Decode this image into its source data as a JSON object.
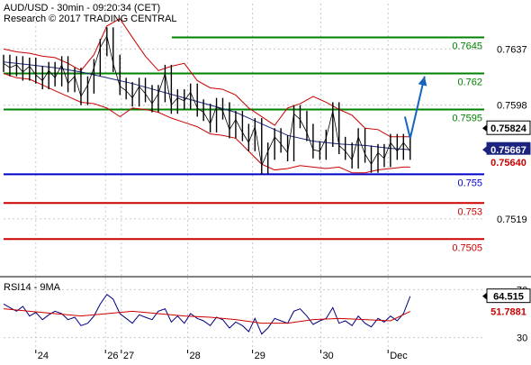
{
  "chart_data": [
    {
      "type": "line",
      "title": "AUD/USD - 30min - 09:20:34 (CET)",
      "subtitle": "Research © 2017 TRADING CENTRAL",
      "ylim": [
        0.74795,
        0.76685
      ],
      "y_ticks": [
        {
          "value": 0.7637,
          "label": "0.7637"
        },
        {
          "value": 0.7598,
          "label": "0.7598"
        },
        {
          "value": 0.7519,
          "label": "0.7519"
        }
      ],
      "x_ticks": [
        {
          "pos": 0.067,
          "label": "24"
        },
        {
          "pos": 0.212,
          "label": "26"
        },
        {
          "pos": 0.245,
          "label": "27"
        },
        {
          "pos": 0.383,
          "label": "28"
        },
        {
          "pos": 0.518,
          "label": "29"
        },
        {
          "pos": 0.66,
          "label": "30"
        },
        {
          "pos": 0.8,
          "label": "Dec"
        }
      ],
      "series": [
        {
          "type": "candles",
          "color": "#000000",
          "x": [
            0.0,
            0.013,
            0.027,
            0.04,
            0.054,
            0.067,
            0.081,
            0.094,
            0.107,
            0.121,
            0.134,
            0.148,
            0.161,
            0.175,
            0.188,
            0.201,
            0.215,
            0.228,
            0.242,
            0.255,
            0.268,
            0.282,
            0.295,
            0.309,
            0.322,
            0.336,
            0.349,
            0.362,
            0.376,
            0.389,
            0.403,
            0.416,
            0.43,
            0.443,
            0.456,
            0.47,
            0.483,
            0.497,
            0.51,
            0.523,
            0.537,
            0.55,
            0.564,
            0.577,
            0.591,
            0.604,
            0.617,
            0.631,
            0.644,
            0.658,
            0.671,
            0.685,
            0.698,
            0.711,
            0.725,
            0.738,
            0.752,
            0.765,
            0.779,
            0.792,
            0.805,
            0.819,
            0.832,
            0.846
          ],
          "close": [
            0.7627,
            0.7624,
            0.7626,
            0.7621,
            0.7625,
            0.7619,
            0.7615,
            0.7622,
            0.7617,
            0.7626,
            0.7613,
            0.7618,
            0.7604,
            0.7612,
            0.7624,
            0.7638,
            0.7646,
            0.7627,
            0.7611,
            0.7608,
            0.7603,
            0.7611,
            0.7606,
            0.7599,
            0.7606,
            0.762,
            0.7598,
            0.7603,
            0.7601,
            0.7607,
            0.7596,
            0.7593,
            0.7585,
            0.7597,
            0.7594,
            0.7581,
            0.7588,
            0.7579,
            0.7572,
            0.7583,
            0.7556,
            0.7566,
            0.7576,
            0.7571,
            0.7565,
            0.7592,
            0.7588,
            0.7579,
            0.7567,
            0.7566,
            0.7575,
            0.7594,
            0.757,
            0.7566,
            0.756,
            0.7576,
            0.7564,
            0.7557,
            0.7565,
            0.7561,
            0.7572,
            0.7566,
            0.7572,
            0.7566
          ]
        },
        {
          "name": "Bollinger",
          "type": "band",
          "color": "#cc0000",
          "x": [
            0.0,
            0.027,
            0.054,
            0.081,
            0.107,
            0.134,
            0.161,
            0.188,
            0.215,
            0.242,
            0.268,
            0.295,
            0.322,
            0.349,
            0.376,
            0.403,
            0.43,
            0.456,
            0.483,
            0.51,
            0.537,
            0.564,
            0.591,
            0.617,
            0.644,
            0.671,
            0.698,
            0.725,
            0.752,
            0.779,
            0.805,
            0.832,
            0.846
          ],
          "upper": [
            0.7637,
            0.7635,
            0.7634,
            0.7632,
            0.7631,
            0.7627,
            0.7622,
            0.7633,
            0.7653,
            0.7658,
            0.7645,
            0.7632,
            0.7622,
            0.7625,
            0.7627,
            0.7615,
            0.761,
            0.7609,
            0.7605,
            0.7596,
            0.759,
            0.7584,
            0.7596,
            0.7599,
            0.7604,
            0.76,
            0.7595,
            0.7591,
            0.7582,
            0.7581,
            0.7576,
            0.7576,
            0.7576
          ],
          "lower": [
            0.762,
            0.7617,
            0.7616,
            0.7612,
            0.7608,
            0.7604,
            0.76,
            0.7599,
            0.7596,
            0.759,
            0.7596,
            0.7595,
            0.7593,
            0.7589,
            0.7586,
            0.7583,
            0.7578,
            0.7577,
            0.7575,
            0.7566,
            0.7557,
            0.7553,
            0.7554,
            0.7556,
            0.7555,
            0.7554,
            0.7555,
            0.7551,
            0.7551,
            0.7553,
            0.7554,
            0.7555,
            0.7555
          ]
        },
        {
          "name": "Moving average",
          "type": "line",
          "color": "#1a237e",
          "x": [
            0.0,
            0.054,
            0.107,
            0.161,
            0.215,
            0.268,
            0.322,
            0.376,
            0.43,
            0.483,
            0.537,
            0.591,
            0.644,
            0.698,
            0.752,
            0.805,
            0.846
          ],
          "y": [
            0.7628,
            0.7626,
            0.7624,
            0.7621,
            0.7617,
            0.7613,
            0.7608,
            0.7603,
            0.7598,
            0.7593,
            0.7585,
            0.7577,
            0.7573,
            0.7571,
            0.757,
            0.7568,
            0.7567
          ]
        },
        {
          "name": "Projection",
          "type": "arrow",
          "color": "#1565c0",
          "x": [
            0.835,
            0.846,
            0.876
          ],
          "y": [
            0.759,
            0.7575,
            0.7618
          ]
        }
      ],
      "levels": [
        {
          "value": 0.7645,
          "label": "0.7645",
          "color": "#008000",
          "x_start": 0.35
        },
        {
          "value": 0.762,
          "label": "0.762",
          "color": "#008000",
          "x_start": 0.0
        },
        {
          "value": 0.7595,
          "label": "0.7595",
          "color": "#008000",
          "x_start": 0.0
        },
        {
          "value": 0.755,
          "label": "0.755",
          "color": "#0000cc",
          "x_start": 0.0
        },
        {
          "value": 0.753,
          "label": "0.753",
          "color": "#cc0000",
          "x_start": 0.0
        },
        {
          "value": 0.7505,
          "label": "0.7505",
          "color": "#cc0000",
          "x_start": 0.0
        }
      ],
      "price_labels": [
        {
          "value": 0.7582,
          "label": "0.75824",
          "fill": "#ffffff",
          "text_color": "#000000",
          "border": "#000000"
        },
        {
          "value": 0.7567,
          "label": "0.75667",
          "fill": "#1a237e",
          "text_color": "#ffffff",
          "border": "#1a237e"
        },
        {
          "value": 0.7564,
          "label": "0.75640",
          "fill": "#ffffff",
          "text_color": "#cc0000",
          "border": "#ffffff"
        }
      ]
    },
    {
      "type": "line",
      "title": "RSI14 - 9MA",
      "ylim": [
        20,
        80
      ],
      "y_ticks": [
        {
          "value": 70,
          "label": "70"
        },
        {
          "value": 30,
          "label": "30"
        }
      ],
      "series": [
        {
          "name": "RSI14",
          "color": "#000080",
          "x": [
            0.0,
            0.013,
            0.027,
            0.04,
            0.054,
            0.067,
            0.081,
            0.094,
            0.107,
            0.121,
            0.134,
            0.148,
            0.161,
            0.175,
            0.188,
            0.201,
            0.215,
            0.228,
            0.242,
            0.255,
            0.268,
            0.282,
            0.295,
            0.309,
            0.322,
            0.336,
            0.349,
            0.362,
            0.376,
            0.389,
            0.403,
            0.416,
            0.43,
            0.443,
            0.456,
            0.47,
            0.483,
            0.497,
            0.51,
            0.523,
            0.537,
            0.55,
            0.564,
            0.577,
            0.591,
            0.604,
            0.617,
            0.631,
            0.644,
            0.658,
            0.671,
            0.685,
            0.698,
            0.711,
            0.725,
            0.738,
            0.752,
            0.765,
            0.779,
            0.792,
            0.805,
            0.819,
            0.832,
            0.846
          ],
          "y": [
            58,
            55,
            52,
            56,
            48,
            51,
            45,
            49,
            52,
            50,
            45,
            47,
            40,
            42,
            48,
            58,
            66,
            62,
            50,
            46,
            42,
            49,
            47,
            45,
            52,
            54,
            43,
            48,
            42,
            50,
            46,
            44,
            40,
            47,
            45,
            38,
            43,
            40,
            35,
            46,
            33,
            38,
            46,
            44,
            42,
            52,
            54,
            48,
            41,
            44,
            46,
            55,
            42,
            44,
            40,
            48,
            42,
            39,
            46,
            43,
            48,
            44,
            50,
            64.5
          ]
        },
        {
          "name": "9MA",
          "color": "#cc0000",
          "x": [
            0.0,
            0.054,
            0.107,
            0.161,
            0.215,
            0.268,
            0.322,
            0.376,
            0.43,
            0.483,
            0.537,
            0.591,
            0.644,
            0.698,
            0.752,
            0.805,
            0.846
          ],
          "y": [
            54,
            52,
            50,
            48,
            50,
            52,
            50,
            48,
            47,
            45,
            42,
            42,
            45,
            46,
            45,
            44,
            51.8
          ]
        }
      ],
      "price_labels": [
        {
          "value": 64.5,
          "label": "64.515",
          "fill": "#ffffff",
          "text_color": "#000000",
          "border": "#000000"
        },
        {
          "value": 51.8,
          "label": "51.7881",
          "fill": "#ffffff",
          "text_color": "#cc0000",
          "border": "#ffffff"
        }
      ]
    }
  ]
}
